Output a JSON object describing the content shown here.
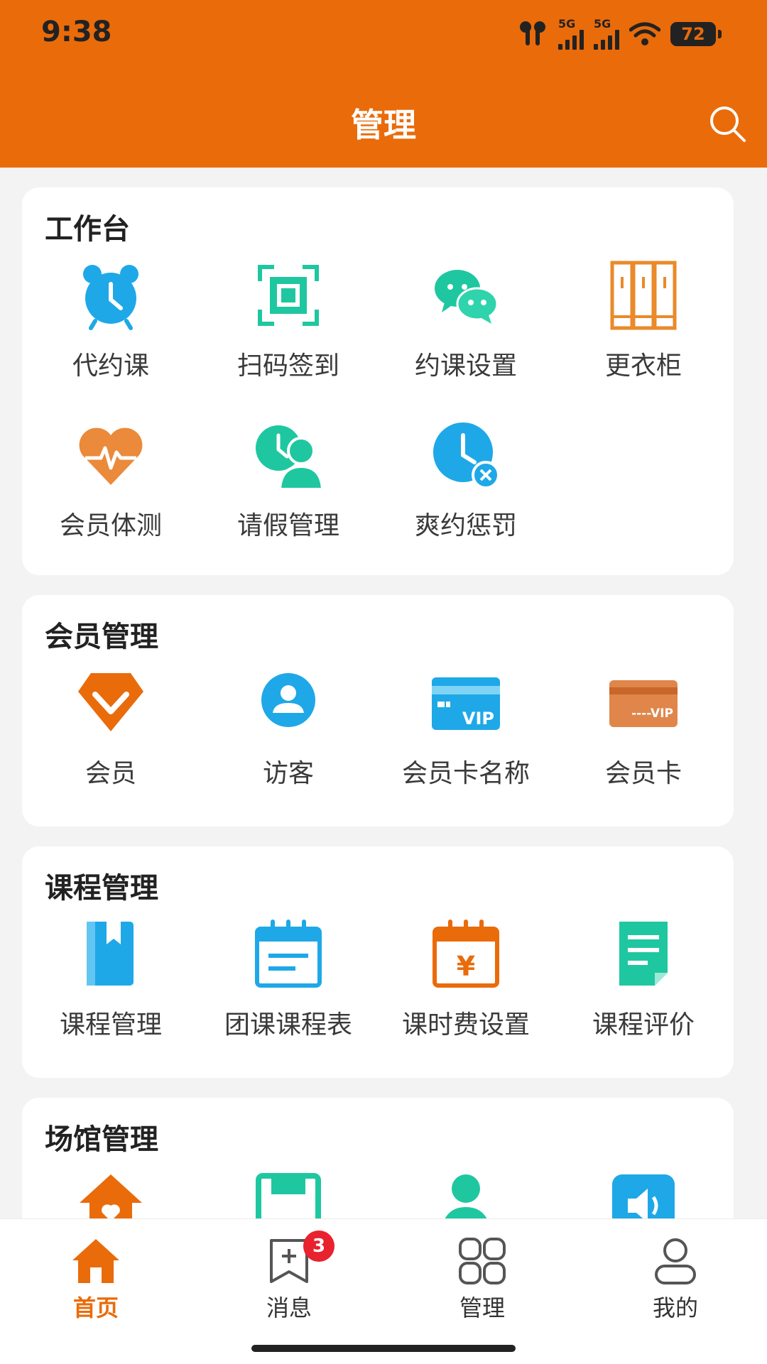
{
  "status_bar": {
    "time": "9:38",
    "signal_1_label": "5G",
    "signal_2_label": "5G",
    "battery": "72"
  },
  "header": {
    "title": "管理"
  },
  "sections": [
    {
      "title": "工作台",
      "items": [
        {
          "label": "代约课",
          "icon": "alarm-clock-icon"
        },
        {
          "label": "扫码签到",
          "icon": "scan-qr-icon"
        },
        {
          "label": "约课设置",
          "icon": "wechat-icon"
        },
        {
          "label": "更衣柜",
          "icon": "locker-icon"
        },
        {
          "label": "会员体测",
          "icon": "heart-pulse-icon"
        },
        {
          "label": "请假管理",
          "icon": "leave-person-icon"
        },
        {
          "label": "爽约惩罚",
          "icon": "clock-cancel-icon"
        }
      ]
    },
    {
      "title": "会员管理",
      "items": [
        {
          "label": "会员",
          "icon": "diamond-icon"
        },
        {
          "label": "访客",
          "icon": "visitor-icon"
        },
        {
          "label": "会员卡名称",
          "icon": "vip-card-blue-icon",
          "card_text": "VIP"
        },
        {
          "label": "会员卡",
          "icon": "vip-card-orange-icon",
          "card_text": "----VIP"
        }
      ]
    },
    {
      "title": "课程管理",
      "items": [
        {
          "label": "课程管理",
          "icon": "bookmark-book-icon"
        },
        {
          "label": "团课课程表",
          "icon": "calendar-list-icon"
        },
        {
          "label": "课时费设置",
          "icon": "calendar-yen-icon",
          "glyph": "¥"
        },
        {
          "label": "课程评价",
          "icon": "document-icon"
        }
      ]
    },
    {
      "title": "场馆管理",
      "items": [
        {
          "icon": "venue-house-icon"
        },
        {
          "icon": "save-icon"
        },
        {
          "icon": "staff-icon"
        },
        {
          "icon": "speaker-icon"
        }
      ]
    }
  ],
  "bottom_nav": [
    {
      "label": "首页",
      "icon": "home-icon",
      "active": true
    },
    {
      "label": "消息",
      "icon": "message-icon",
      "badge": "3"
    },
    {
      "label": "管理",
      "icon": "grid-icon"
    },
    {
      "label": "我的",
      "icon": "profile-icon"
    }
  ],
  "colors": {
    "brand": "#ea6b0a",
    "badge": "#e8222e",
    "teal": "#1fc7a0",
    "blue": "#1ea8e8"
  }
}
